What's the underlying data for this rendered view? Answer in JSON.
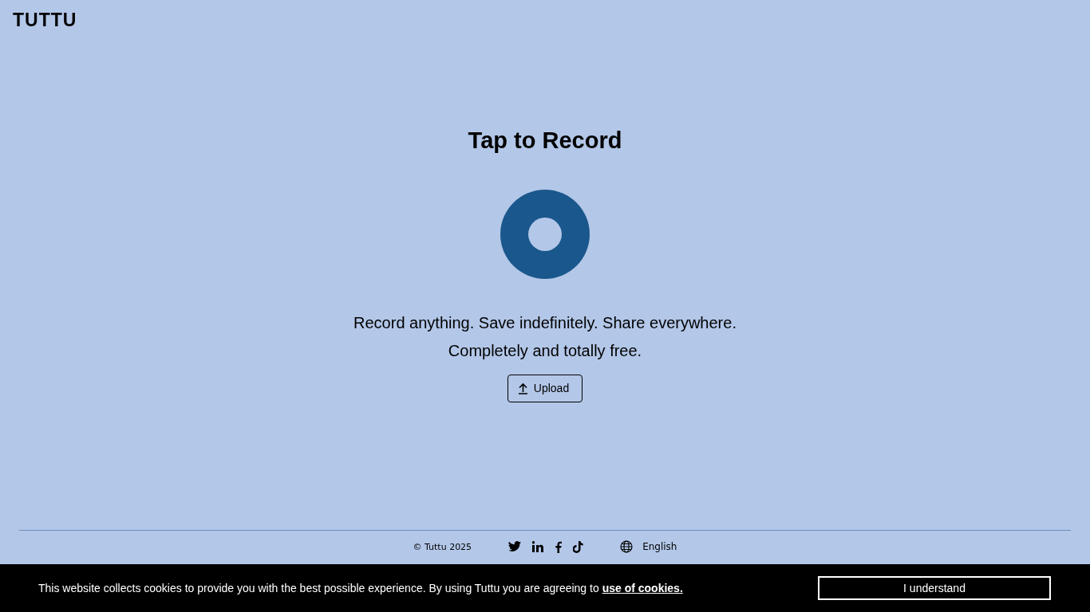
{
  "header": {
    "logo": "TUTTU"
  },
  "main": {
    "title": "Tap to Record",
    "tagline": [
      "Record anything. Save indefinitely. Share everywhere.",
      "Completely and totally free."
    ],
    "upload_button": "Upload"
  },
  "footer": {
    "copyright": "© Tuttu 2025",
    "social": [
      {
        "kind": "twitter"
      },
      {
        "kind": "linkedin"
      },
      {
        "kind": "facebook"
      },
      {
        "kind": "tiktok"
      }
    ],
    "language": "English"
  },
  "cookie_bar": {
    "text": "This website collects cookies to provide you with the best possible experience. By using Tuttu you are agreeing to",
    "link": "use of cookies.",
    "button": "I understand"
  }
}
